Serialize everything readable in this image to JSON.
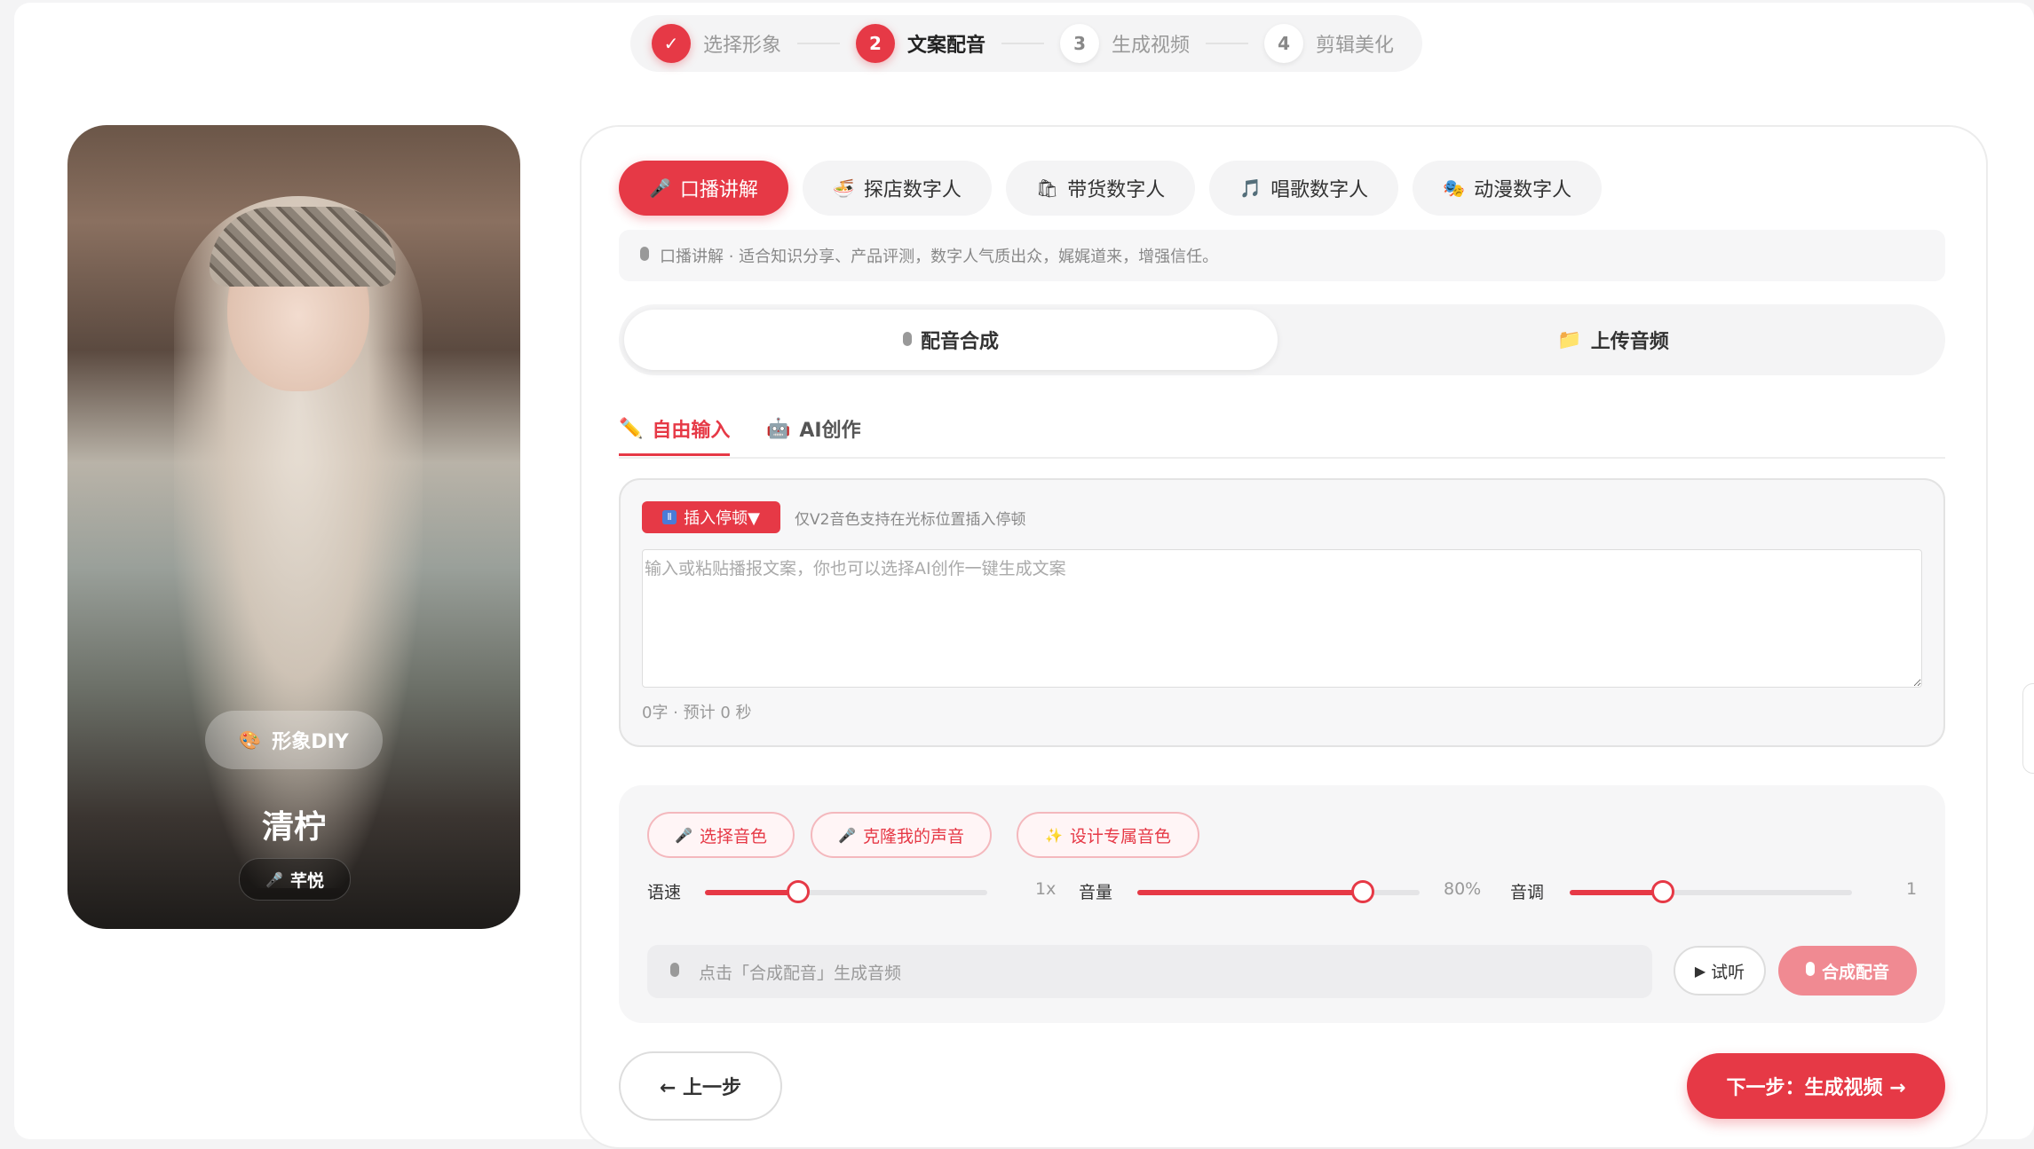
{
  "stepper": {
    "steps": [
      {
        "num": "✓",
        "label": "选择形象"
      },
      {
        "num": "2",
        "label": "文案配音"
      },
      {
        "num": "3",
        "label": "生成视频"
      },
      {
        "num": "4",
        "label": "剪辑美化"
      }
    ]
  },
  "avatar": {
    "diy_label": "形象DIY",
    "name": "清柠",
    "voice_name": "芊悦"
  },
  "categories": [
    {
      "icon": "🎤",
      "label": "口播讲解",
      "active": true
    },
    {
      "icon": "🍜",
      "label": "探店数字人"
    },
    {
      "icon": "🛍",
      "label": "带货数字人"
    },
    {
      "icon": "🎵",
      "label": "唱歌数字人"
    },
    {
      "icon": "🎭",
      "label": "动漫数字人"
    }
  ],
  "description": "口播讲解 · 适合知识分享、产品评测，数字人气质出众，娓娓道来，增强信任。",
  "mode": {
    "synth_label": "配音合成",
    "upload_label": "上传音频"
  },
  "subtabs": {
    "free_input": "自由输入",
    "ai_create": "AI创作"
  },
  "editor": {
    "pause_button": "插入停顿▼",
    "pause_hint": "仅V2音色支持在光标位置插入停顿",
    "placeholder": "输入或粘贴播报文案，你也可以选择AI创作一键生成文案",
    "char_count": "0字 · 预计 0 秒"
  },
  "voice": {
    "select_voice": "选择音色",
    "clone_voice": "克隆我的声音",
    "design_voice": "设计专属音色",
    "speed_label": "语速",
    "speed_value": "1x",
    "speed_fraction": 0.33,
    "volume_label": "音量",
    "volume_value": "80%",
    "volume_fraction": 0.8,
    "pitch_label": "音调",
    "pitch_value": "1",
    "pitch_fraction": 0.33,
    "status_text": "点击「合成配音」生成音频",
    "preview_label": "试听",
    "synth_label": "合成配音"
  },
  "nav": {
    "prev": "← 上一步",
    "next": "下一步：生成视频 →"
  },
  "colors": {
    "accent": "#e63946",
    "accent_light": "#f08a92"
  }
}
